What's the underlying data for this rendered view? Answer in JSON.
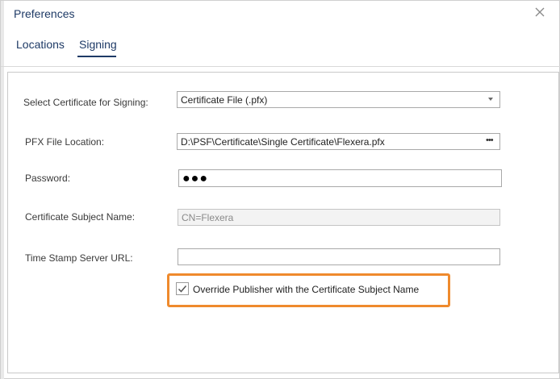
{
  "dialog": {
    "title": "Preferences"
  },
  "tabs": [
    {
      "label": "Locations",
      "active": false
    },
    {
      "label": "Signing",
      "active": true
    }
  ],
  "signing": {
    "certificate_label": "Select Certificate for Signing:",
    "certificate_value": "Certificate File (.pfx)",
    "pfx_label": "PFX File Location:",
    "pfx_value": "D:\\PSF\\Certificate\\Single Certificate\\Flexera.pfx",
    "browse_label": "•••",
    "password_label": "Password:",
    "password_value": "●●●",
    "subject_label": "Certificate Subject Name:",
    "subject_value": "CN=Flexera",
    "timestamp_label": "Time Stamp Server URL:",
    "timestamp_value": "",
    "override_label": "Override Publisher with the Certificate Subject Name",
    "override_checked": true
  },
  "colors": {
    "accent": "#1e3a66",
    "highlight": "#ef8a2d"
  },
  "icons": {
    "close": "close-icon",
    "dropdown": "chevron-down-icon",
    "checkmark": "checkmark-icon",
    "browse": "ellipsis-icon"
  }
}
